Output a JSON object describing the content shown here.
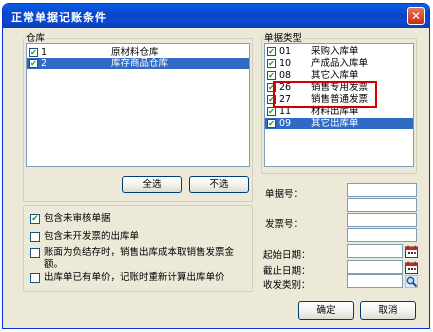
{
  "window": {
    "title": "正常单据记账条件",
    "close_glyph": "✕"
  },
  "warehouse": {
    "legend": "仓库",
    "items": [
      {
        "code": "1",
        "name": "原材料仓库",
        "checked": true,
        "selected": false
      },
      {
        "code": "2",
        "name": "库存商品仓库",
        "checked": true,
        "selected": true
      }
    ],
    "select_all_label": "全选",
    "deselect_label": "不选"
  },
  "doc_types": {
    "legend": "单据类型",
    "items": [
      {
        "code": "01",
        "name": "采购入库单",
        "checked": true,
        "selected": false
      },
      {
        "code": "10",
        "name": "产成品入库单",
        "checked": true,
        "selected": false
      },
      {
        "code": "08",
        "name": "其它入库单",
        "checked": true,
        "selected": false
      },
      {
        "code": "26",
        "name": "销售专用发票",
        "checked": true,
        "selected": false
      },
      {
        "code": "27",
        "name": "销售普通发票",
        "checked": true,
        "selected": false
      },
      {
        "code": "11",
        "name": "材料出库单",
        "checked": true,
        "selected": false
      },
      {
        "code": "09",
        "name": "其它出库单",
        "checked": true,
        "selected": true
      }
    ],
    "highlight_color": "#d40000"
  },
  "options": [
    {
      "label": "包含未审核单据",
      "checked": true
    },
    {
      "label": "包含未开发票的出库单",
      "checked": false
    },
    {
      "label": "账面为负结存时，销售出库成本取销售发票金额。",
      "checked": false
    },
    {
      "label": "出库单已有单价，记账时重新计算出库单价",
      "checked": false
    }
  ],
  "fields": {
    "doc_no_label": "单据号：",
    "invoice_no_label": "发票号：",
    "start_date_label": "起始日期：",
    "end_date_label": "截止日期：",
    "send_category_label": "收发类别：",
    "doc_no_from": "",
    "doc_no_to": "",
    "invoice_no_from": "",
    "invoice_no_to": "",
    "start_date": "",
    "end_date": "",
    "send_category": ""
  },
  "icons": {
    "calendar": "calendar-icon",
    "search": "magnifier-icon"
  },
  "footer": {
    "ok_label": "确定",
    "cancel_label": "取消"
  }
}
